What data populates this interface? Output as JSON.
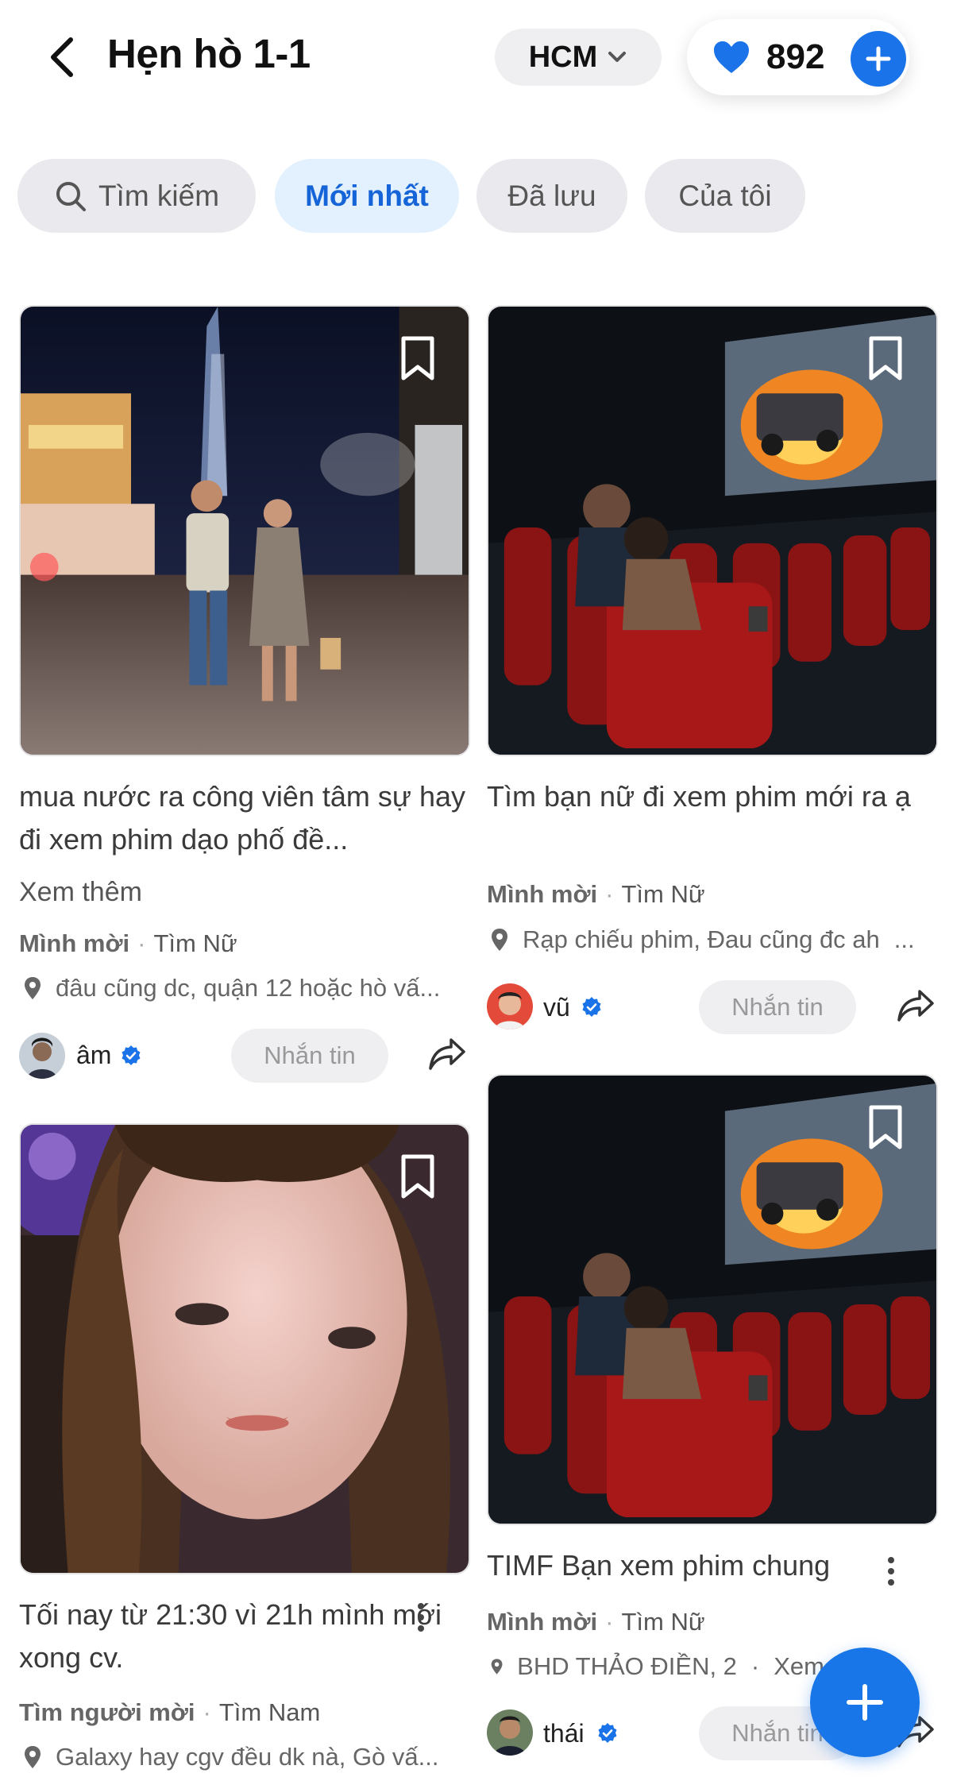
{
  "header": {
    "title": "Hẹn hò 1-1",
    "city": "HCM",
    "likes": "892"
  },
  "tabs": {
    "search": "Tìm kiếm",
    "newest": "Mới nhất",
    "saved": "Đã lưu",
    "mine": "Của tôi"
  },
  "posts": [
    {
      "title": "mua nước ra công viên tâm sự hay đi xem phim dạo phố đề...",
      "more": "Xem thêm",
      "type": "Mình mời",
      "target": "Tìm Nữ",
      "location": "đâu cũng dc, quận 12 hoặc hò vấ...",
      "author": "âm",
      "message": "Nhắn tin"
    },
    {
      "title": "Tìm bạn nữ đi xem phim mới ra ạ",
      "type": "Mình mời",
      "target": "Tìm Nữ",
      "location": "Rạp chiếu phim, Đau cũng đc ah",
      "location_more": "...",
      "author": "vũ",
      "message": "Nhắn tin"
    },
    {
      "title": "Tối nay từ 21:30 vì 21h mình mới xong cv.",
      "type": "Tìm người mời",
      "target": "Tìm Nam",
      "location": "Galaxy hay cgv đều dk nà, Gò vấ..."
    },
    {
      "title": "TIMF Bạn xem phim chung",
      "type": "Mình mời",
      "target": "Tìm Nữ",
      "location": "BHD THẢO ĐIỀN, 2",
      "location_more": "Xem",
      "author": "thái",
      "message": "Nhắn tin"
    }
  ],
  "colors": {
    "accent": "#1a73e8",
    "active_tab_bg": "#e3f0fd",
    "pill_bg": "#efeff2"
  },
  "icons": {
    "back": "chevron-left-icon",
    "dropdown": "chevron-down-icon",
    "heart": "heart-icon",
    "plus": "plus-icon",
    "search": "search-icon",
    "bookmark": "bookmark-icon",
    "location": "location-pin-icon",
    "verified": "verified-badge-icon",
    "share": "share-icon"
  }
}
